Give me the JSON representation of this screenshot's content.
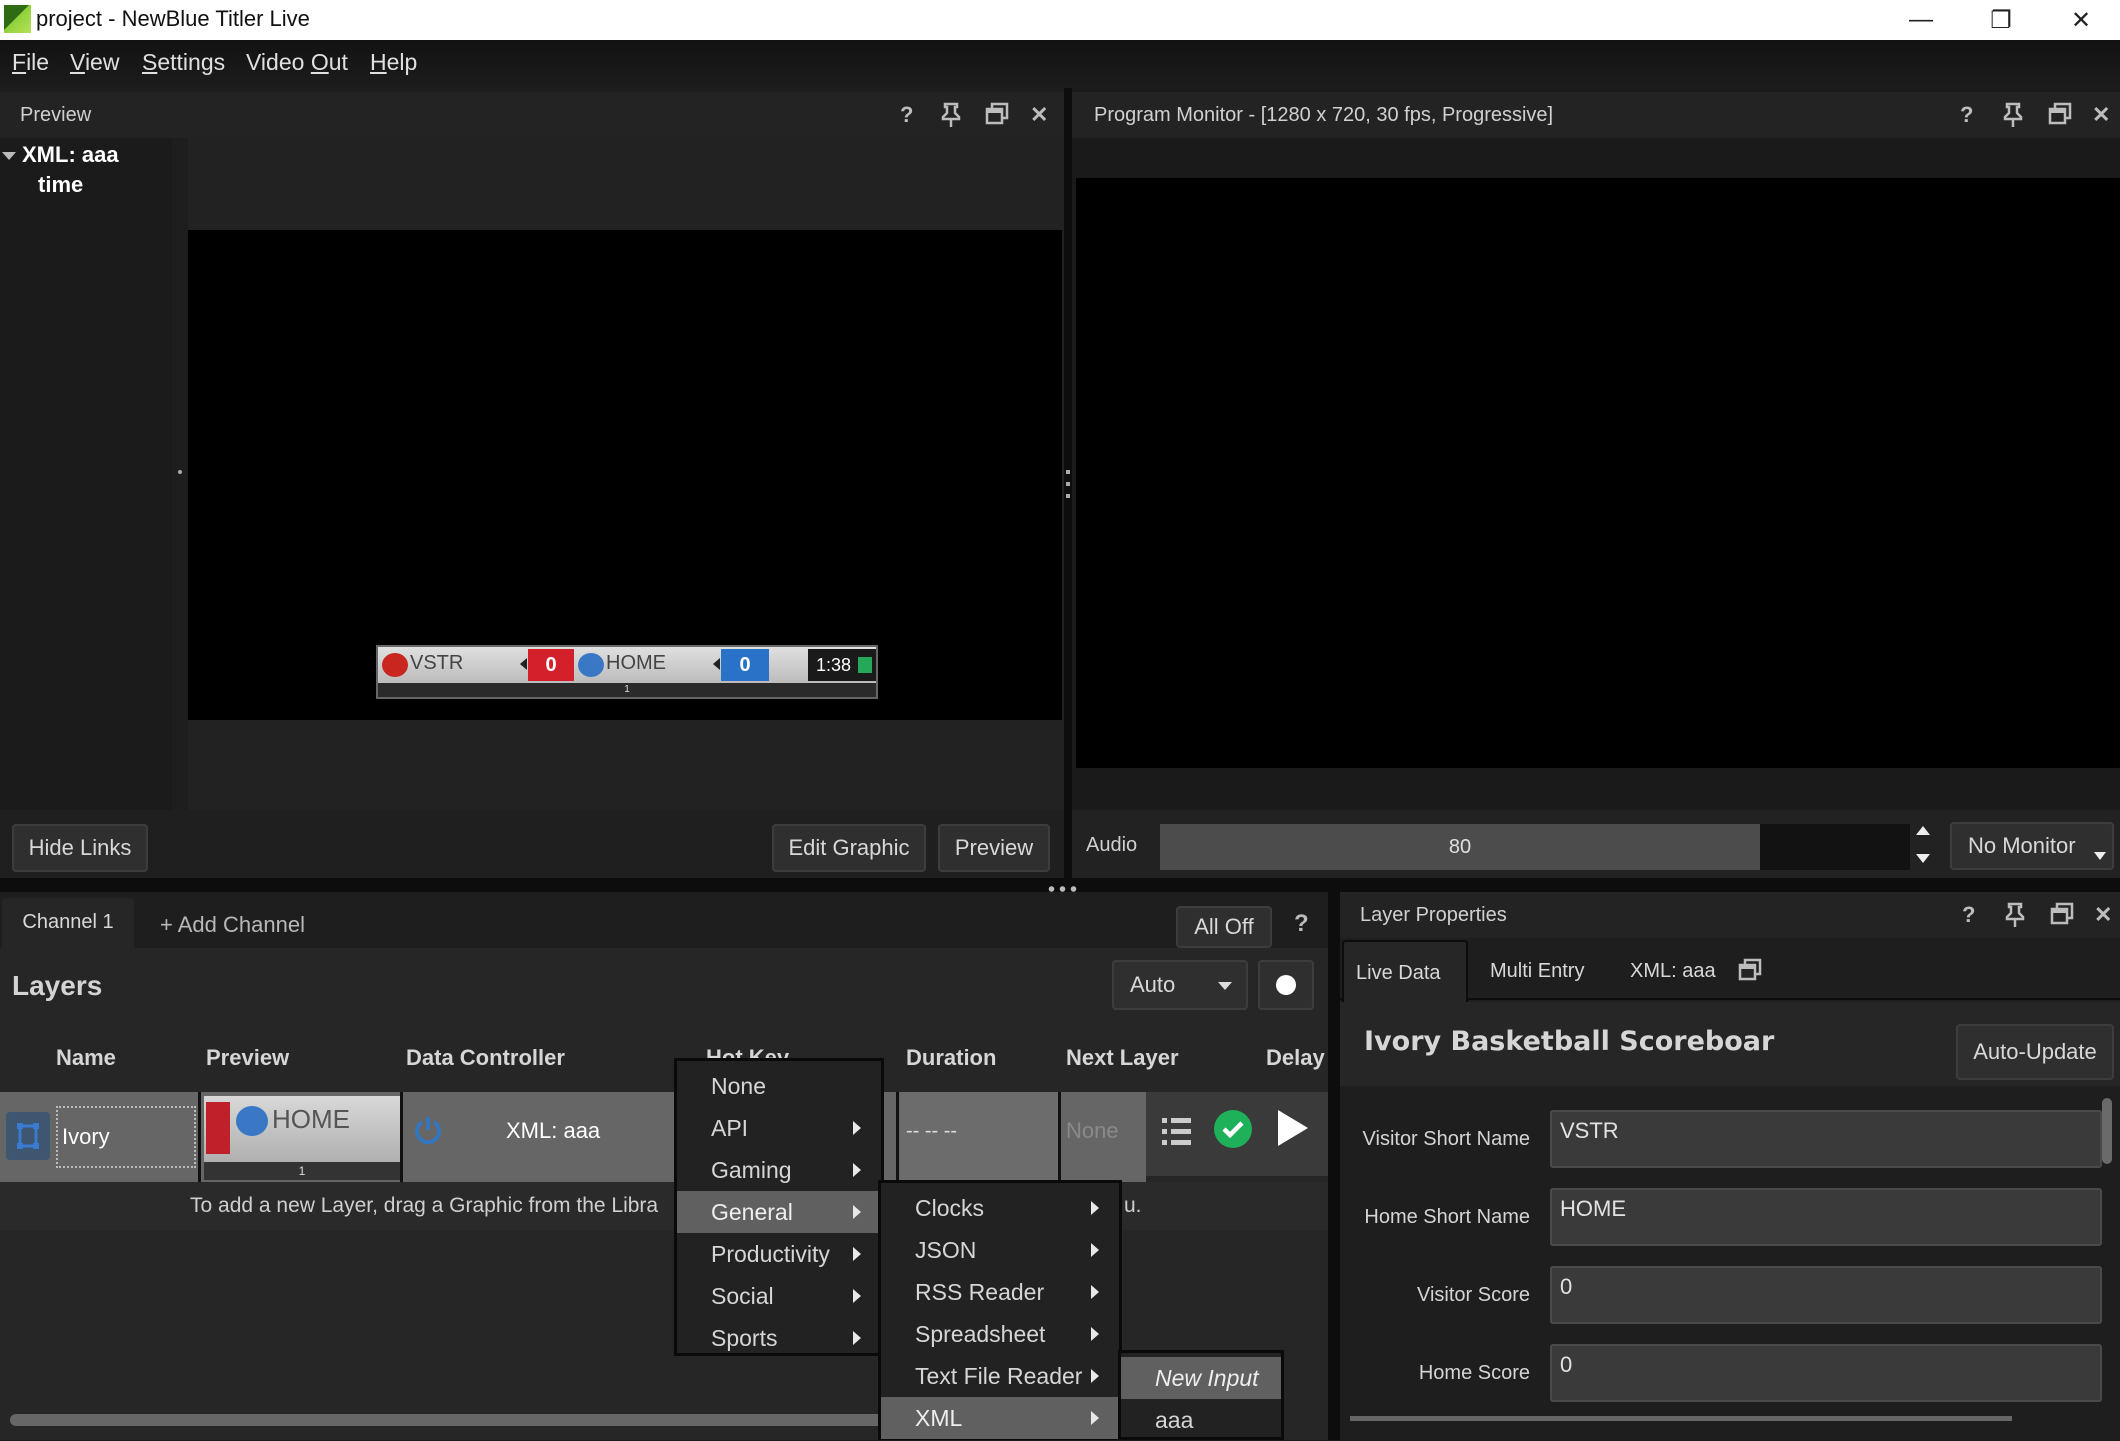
{
  "window": {
    "title": "project - NewBlue Titler Live",
    "controls": {
      "minimize": "—",
      "restore": "❐",
      "close": "✕"
    }
  },
  "menubar": {
    "items": [
      {
        "label": "File",
        "mnemonic": "F",
        "rest": "ile"
      },
      {
        "label": "View",
        "mnemonic": "V",
        "rest": "iew"
      },
      {
        "label": "Settings",
        "mnemonic": "S",
        "rest": "ettings"
      },
      {
        "label": "Video Out",
        "prefix": "Video ",
        "mnemonic": "O",
        "rest": "ut"
      },
      {
        "label": "Help",
        "mnemonic": "H",
        "rest": "elp"
      }
    ]
  },
  "preview_panel": {
    "title": "Preview",
    "tree": {
      "root": "XML: aaa",
      "child": "time"
    },
    "buttons": {
      "hide_links": "Hide Links",
      "edit_graphic": "Edit Graphic",
      "preview": "Preview"
    },
    "scoreboard": {
      "visitor_name": "VSTR",
      "visitor_score": "0",
      "home_name": "HOME",
      "home_score": "0",
      "clock": "1:38",
      "period": "1",
      "visitor_color": "#d4202a",
      "home_color": "#2a72c8"
    }
  },
  "panel_icons": {
    "help": "?",
    "pin": "pin-icon",
    "float": "float-icon",
    "close": "✕"
  },
  "program_monitor": {
    "title": "Program Monitor - [1280 x 720, 30 fps, Progressive]",
    "audio_label": "Audio",
    "audio_value": "80",
    "audio_level_fraction": 0.8,
    "monitor_select": "No Monitor"
  },
  "channels": {
    "tabs": [
      {
        "label": "Channel 1",
        "active": true
      }
    ],
    "add_channel": "+ Add Channel",
    "all_off": "All Off",
    "help": "?"
  },
  "layers": {
    "title": "Layers",
    "mode_select": "Auto",
    "columns": [
      "Name",
      "Preview",
      "Data Controller",
      "Hot Key",
      "Duration",
      "Next Layer",
      "Delay"
    ],
    "rows": [
      {
        "name": "Ivory Baske...",
        "preview_text": "HOME",
        "preview_period": "1",
        "data_controller": "XML: aaa",
        "duration": "-- -- --",
        "next_layer": "None"
      }
    ],
    "hint": "To add a new Layer, drag a Graphic from the Libra",
    "hint_tail": "u."
  },
  "context_menu": {
    "level1": [
      {
        "label": "None",
        "submenu": false
      },
      {
        "label": "API",
        "submenu": true
      },
      {
        "label": "Gaming",
        "submenu": true
      },
      {
        "label": "General",
        "submenu": true,
        "selected": true
      },
      {
        "label": "Productivity",
        "submenu": true
      },
      {
        "label": "Social",
        "submenu": true
      },
      {
        "label": "Sports",
        "submenu": true
      }
    ],
    "level2": [
      {
        "label": "Clocks",
        "submenu": true
      },
      {
        "label": "JSON",
        "submenu": true
      },
      {
        "label": "RSS Reader",
        "submenu": true
      },
      {
        "label": "Spreadsheet",
        "submenu": true
      },
      {
        "label": "Text File Reader",
        "submenu": true
      },
      {
        "label": "XML",
        "submenu": true,
        "selected": true
      }
    ],
    "level3": [
      {
        "label": "New Input",
        "selected": true
      },
      {
        "label": "aaa"
      }
    ]
  },
  "layer_properties": {
    "title": "Layer Properties",
    "tabs": [
      {
        "label": "Live Data",
        "active": true
      },
      {
        "label": "Multi Entry"
      },
      {
        "label": "XML: aaa"
      }
    ],
    "graphic_title": "Ivory Basketball Scoreboar",
    "auto_update": "Auto-Update",
    "fields": [
      {
        "label": "Visitor Short Name",
        "value": "VSTR"
      },
      {
        "label": "Home Short Name",
        "value": "HOME"
      },
      {
        "label": "Visitor Score",
        "value": "0"
      },
      {
        "label": "Home Score",
        "value": "0"
      }
    ]
  }
}
